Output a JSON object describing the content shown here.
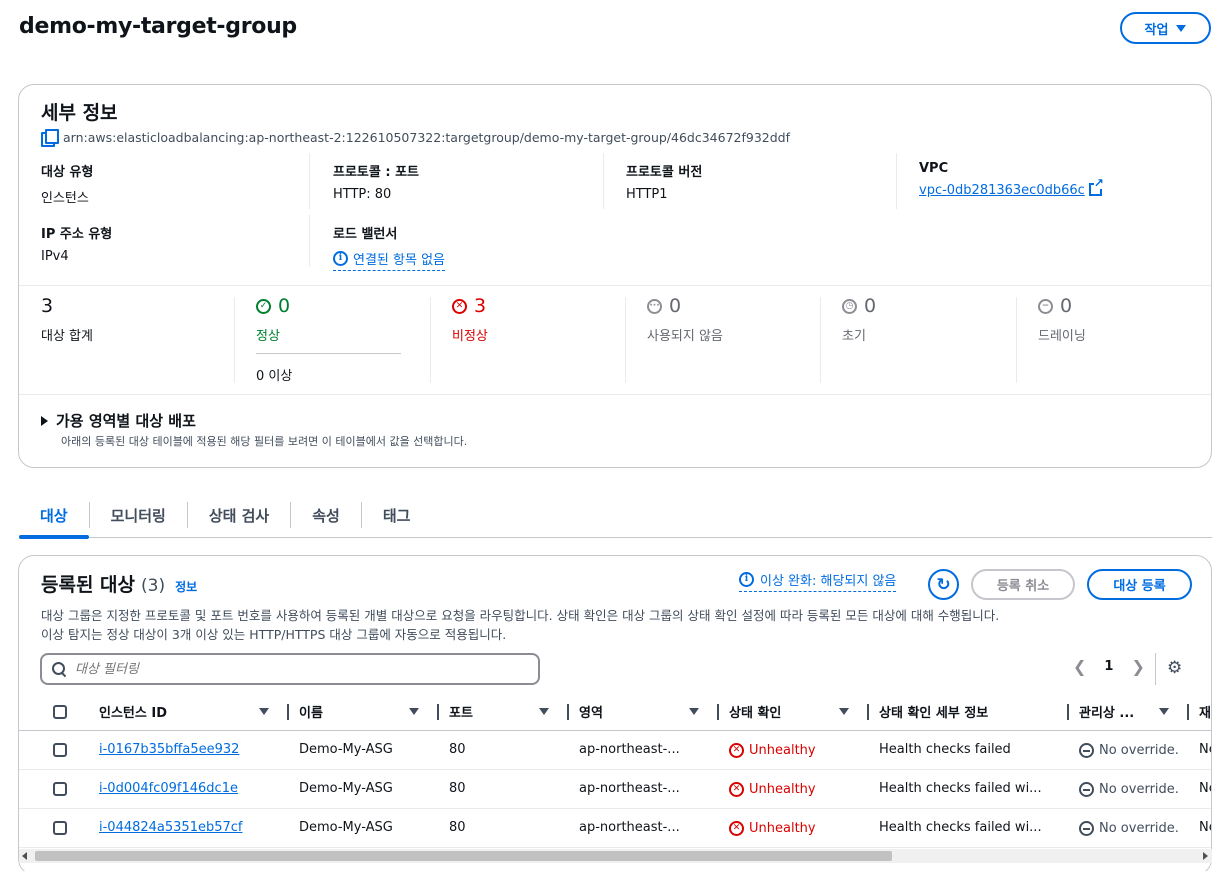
{
  "page": {
    "title": "demo-my-target-group",
    "actions_label": "작업"
  },
  "details": {
    "title": "세부 정보",
    "arn": "arn:aws:elasticloadbalancing:ap-northeast-2:122610507322:targetgroup/demo-my-target-group/46dc34672f932ddf",
    "target_type_label": "대상 유형",
    "target_type_value": "인스턴스",
    "protocol_port_label": "프로토콜 : 포트",
    "protocol_port_value": "HTTP: 80",
    "protocol_version_label": "프로토콜 버전",
    "protocol_version_value": "HTTP1",
    "vpc_label": "VPC",
    "vpc_value": "vpc-0db281363ec0db66c",
    "ip_type_label": "IP 주소 유형",
    "ip_type_value": "IPv4",
    "load_balancer_label": "로드 밸런서",
    "load_balancer_value": "연결된 항목 없음"
  },
  "stats": {
    "total": {
      "value": "3",
      "label": "대상 합계"
    },
    "healthy": {
      "value": "0",
      "label": "정상",
      "sub": "0 이상",
      "color": "#00802f"
    },
    "unhealthy": {
      "value": "3",
      "label": "비정상",
      "color": "#db0000"
    },
    "unused": {
      "value": "0",
      "label": "사용되지 않음",
      "color": "#656871"
    },
    "initial": {
      "value": "0",
      "label": "초기",
      "color": "#656871"
    },
    "draining": {
      "value": "0",
      "label": "드레이닝",
      "color": "#656871"
    }
  },
  "distribution": {
    "title": "가용 영역별 대상 배포",
    "description": "아래의 등록된 대상 테이블에 적용된 해당 필터를 보려면 이 테이블에서 값을 선택합니다."
  },
  "tabs": [
    "대상",
    "모니터링",
    "상태 검사",
    "속성",
    "태그"
  ],
  "registered": {
    "title": "등록된 대상",
    "count": "(3)",
    "info_label": "정보",
    "anomaly_label": "이상 완화: 해당되지 않음",
    "deregister_label": "등록 취소",
    "register_label": "대상 등록",
    "desc_line1": "대상 그룹은 지정한 프로토콜 및 포트 번호를 사용하여 등록된 개별 대상으로 요청을 라우팅합니다. 상태 확인은 대상 그룹의 상태 확인 설정에 따라 등록된 모든 대상에 대해 수행됩니다.",
    "desc_line2": "이상 탐지는 정상 대상이 3개 이상 있는 HTTP/HTTPS 대상 그룹에 자동으로 적용됩니다.",
    "filter_placeholder": "대상 필터링",
    "page_number": "1"
  },
  "table": {
    "columns": [
      "인스턴스 ID",
      "이름",
      "포트",
      "영역",
      "상태 확인",
      "상태 확인 세부 정보",
      "관리상 ...",
      "재"
    ],
    "rows": [
      {
        "id": "i-0167b35bffa5ee932",
        "name": "Demo-My-ASG",
        "port": "80",
        "zone": "ap-northeast-...",
        "status": "Unhealthy",
        "details": "Health checks failed",
        "override": "No override.",
        "extra": "Ne"
      },
      {
        "id": "i-0d004fc09f146dc1e",
        "name": "Demo-My-ASG",
        "port": "80",
        "zone": "ap-northeast-...",
        "status": "Unhealthy",
        "details": "Health checks failed wi...",
        "override": "No override.",
        "extra": "Ne"
      },
      {
        "id": "i-044824a5351eb57cf",
        "name": "Demo-My-ASG",
        "port": "80",
        "zone": "ap-northeast-...",
        "status": "Unhealthy",
        "details": "Health checks failed wi...",
        "override": "No override.",
        "extra": "Ne"
      }
    ]
  },
  "icons": {
    "copy": "copy-icon",
    "info": "info-icon",
    "external": "external-link-icon",
    "search": "search-icon",
    "refresh": "refresh-icon",
    "settings": "gear-icon"
  },
  "colors": {
    "accent": "#006ce0",
    "error": "#db0000",
    "success": "#00802f"
  }
}
